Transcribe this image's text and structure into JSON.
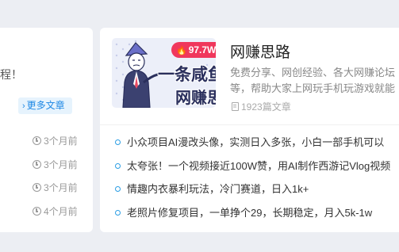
{
  "left_card": {
    "desc_tail": "程！",
    "more_label": "更多文章",
    "times": [
      "3个月前",
      "3个月前",
      "3个月前",
      "4个月前"
    ]
  },
  "right_card": {
    "hot_count": "97.7W+",
    "cover_line1": "一条咸鱼的",
    "cover_line2": "网赚思路",
    "title": "网赚思路",
    "desc_line1": "免费分享、网创经验、各大网赚论坛",
    "desc_line2": "等，帮助大家上网玩手机玩游戏就能",
    "article_count": "1923篇文章",
    "articles": [
      "小众项目AI漫改头像，实测日入多张，小白一部手机可以",
      "太夸张！一个视频接近100W赞，用AI制作西游记Vlog视频",
      "情趣内衣暴利玩法，冷门赛道，日入1k+",
      "老照片修复项目，一单挣个29，长期稳定，月入5k-1w"
    ]
  },
  "colors": {
    "accent": "#1e88e5",
    "hot_badge": "#f0375c",
    "dot": "#2a9de4",
    "background": "#eceef3"
  },
  "icons": {
    "more_chevron": "chevron-right-icon",
    "time": "clock-icon",
    "article_count": "document-icon",
    "hot": "flame-icon",
    "list_bullet": "ring-dot-icon"
  }
}
